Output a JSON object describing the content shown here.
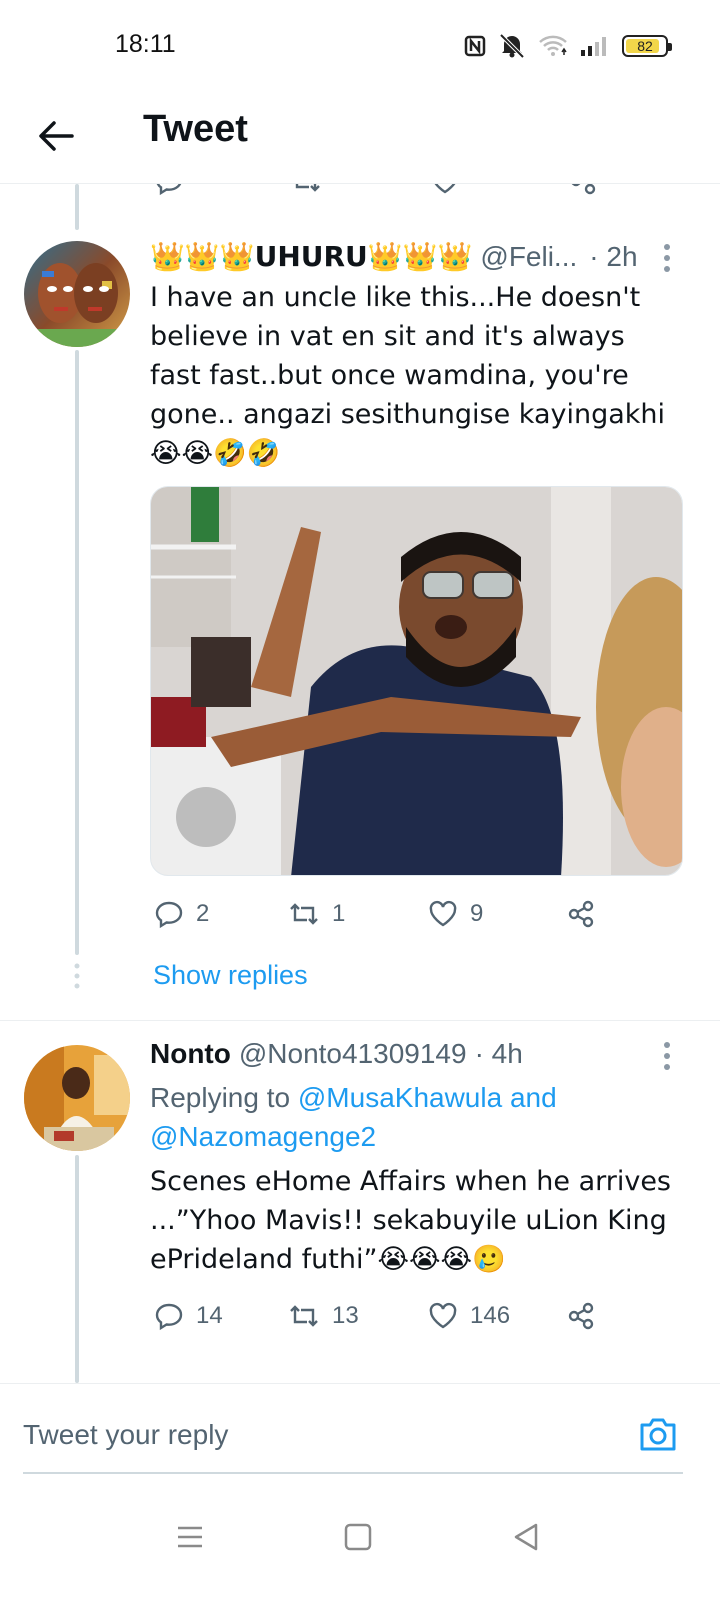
{
  "status_bar": {
    "time": "18:11",
    "battery": "82",
    "icons": [
      "nfc-icon",
      "mute-icon",
      "wifi-icon",
      "signal-icon",
      "battery-icon"
    ]
  },
  "header": {
    "title": "Tweet",
    "back_icon": "arrow-left-icon"
  },
  "tweets": [
    {
      "display_name": "👑👑👑UHURU👑👑👑",
      "handle": "@Feli...",
      "time": "· 2h",
      "text": "I have an uncle like this...He doesn't believe in vat en sit and it's always fast fast..but once wamdina, you're gone.. angazi sesithungise kayingakhi😭😭🤣🤣",
      "has_media": true,
      "actions": {
        "replies": "2",
        "retweets": "1",
        "likes": "9"
      },
      "show_replies": "Show replies"
    },
    {
      "display_name": "Nonto",
      "handle": "@Nonto41309149",
      "time": "· 4h",
      "replying_prefix": "Replying to",
      "replying_users": "@MusaKhawula and @Nazomagenge2",
      "text": "Scenes eHome Affairs when he arrives ...”Yhoo Mavis!! sekabuyile uLion King ePrideland futhi”😭😭😭🥲",
      "actions": {
        "replies": "14",
        "retweets": "13",
        "likes": "146"
      }
    }
  ],
  "reply_box": {
    "placeholder": "Tweet your reply",
    "camera_icon": "camera-icon"
  },
  "colors": {
    "accent": "#1d9bf0",
    "muted": "#536471",
    "text": "#0f1419",
    "thread_line": "#cfd9de"
  }
}
